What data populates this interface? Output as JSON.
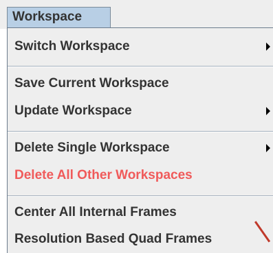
{
  "menubar": {
    "title": "Workspace"
  },
  "menu": {
    "items": [
      {
        "label": "Switch Workspace",
        "submenu": true
      },
      {
        "label": "Save Current Workspace",
        "submenu": false
      },
      {
        "label": "Update Workspace",
        "submenu": true
      },
      {
        "label": "Delete Single Workspace",
        "submenu": true
      },
      {
        "label": "Delete All Other Workspaces",
        "submenu": false,
        "color": "#f05a5a"
      },
      {
        "label": "Center All Internal Frames",
        "submenu": false
      },
      {
        "label": "Resolution Based Quad Frames",
        "submenu": false
      }
    ]
  },
  "colors": {
    "menu_bg": "#eeeeee",
    "menubar_tab_bg": "#b8cfe5",
    "text": "#333333",
    "danger_text": "#f05a5a"
  }
}
